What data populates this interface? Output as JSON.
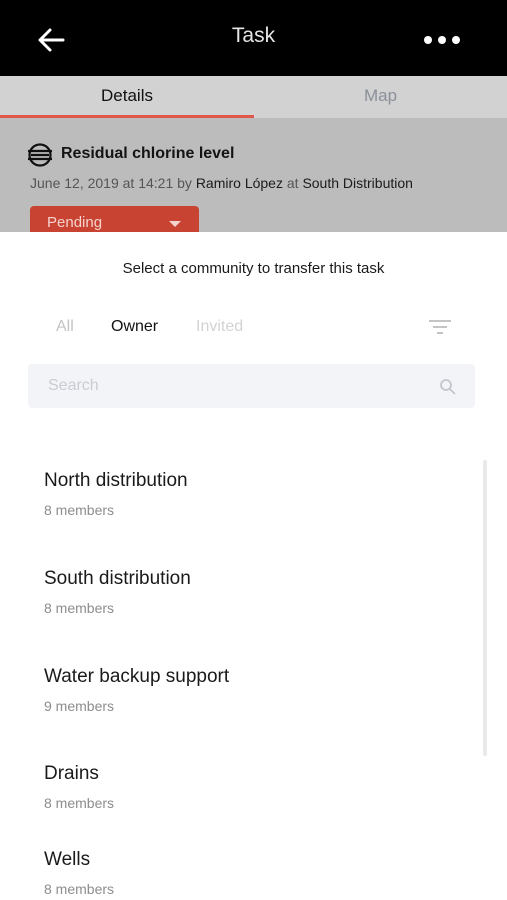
{
  "header": {
    "title": "Task"
  },
  "tabs": [
    {
      "label": "Details"
    },
    {
      "label": "Map"
    }
  ],
  "task": {
    "title": "Residual chlorine level",
    "date": "June 12, 2019 at 14:21",
    "by_word": "by",
    "author": "Ramiro López",
    "at_word": "at",
    "location": "South Distribution",
    "status": "Pending"
  },
  "sheet": {
    "title": "Select a community to transfer this task",
    "filters": [
      "All",
      "Owner",
      "Invited"
    ],
    "search": {
      "placeholder": "Search"
    },
    "communities": [
      {
        "name": "North distribution",
        "members": "8 members"
      },
      {
        "name": "South distribution",
        "members": "8 members"
      },
      {
        "name": "Water backup support",
        "members": "9 members"
      },
      {
        "name": "Drains",
        "members": "8 members"
      },
      {
        "name": "Wells",
        "members": "8 members"
      }
    ]
  },
  "colors": {
    "accent": "#e1584a",
    "status_bg": "#c94333",
    "appbar_bg": "#000000"
  },
  "icons": {
    "back": "arrow-left-icon",
    "more": "more-horizontal-icon",
    "task": "task-type-icon",
    "status": "caret-down-icon",
    "filter": "filter-icon",
    "search": "search-icon"
  }
}
